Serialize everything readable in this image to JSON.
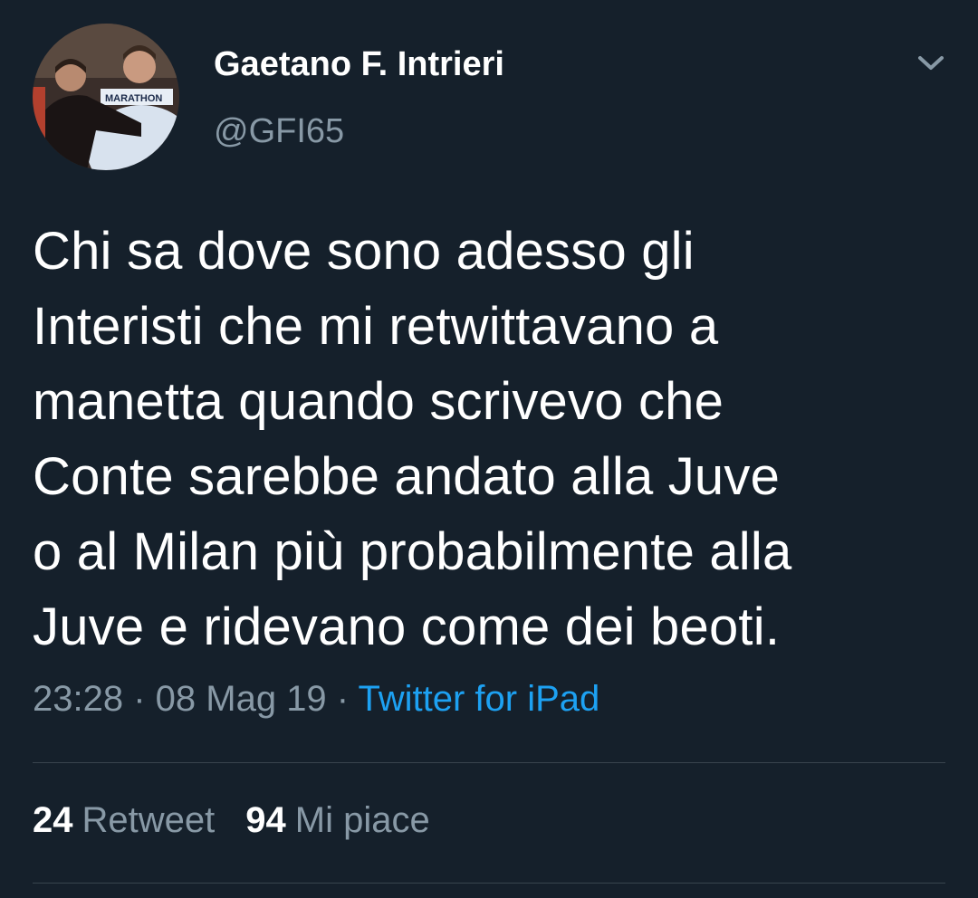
{
  "author": {
    "name": "Gaetano F. Intrieri",
    "handle": "@GFI65",
    "avatar_icon": "profile-photo"
  },
  "tweet": {
    "text": "Chi sa dove sono adesso gli\nInteristi che mi retwittavano a\nmanetta quando scrivevo che\nConte sarebbe andato alla Juve\no al Milan più probabilmente alla\nJuve e ridevano come dei beoti.",
    "time": "23:28",
    "separator": " · ",
    "date": "08 Mag 19",
    "source": "Twitter for iPad"
  },
  "stats": {
    "retweets_count": "24",
    "retweets_label": "Retweet",
    "likes_count": "94",
    "likes_label": "Mi piace"
  },
  "colors": {
    "background": "#15202b",
    "secondary_text": "#8899a6",
    "link": "#1da1f2",
    "divider": "#38444d"
  }
}
